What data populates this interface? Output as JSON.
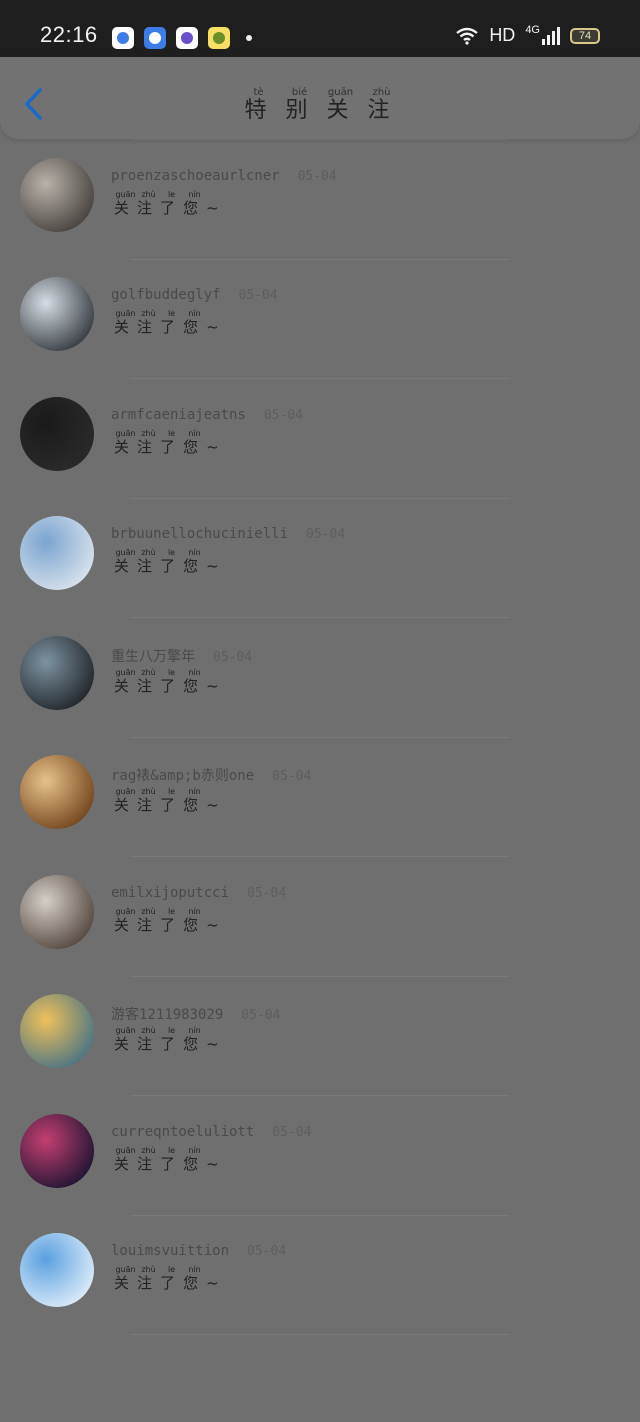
{
  "status_bar": {
    "time": "22:16",
    "network_label": "HD",
    "network_type": "4G",
    "battery": "74",
    "app_icons": [
      {
        "name": "app-icon-1",
        "color": "#ffffff",
        "dot": "#3d7be6"
      },
      {
        "name": "app-icon-2",
        "color": "#3d7be6",
        "dot": "#ffffff"
      },
      {
        "name": "app-icon-3",
        "color": "#ffffff",
        "dot": "#6a4fcf"
      },
      {
        "name": "app-icon-4",
        "color": "#f6df62",
        "dot": "#6a8f2a"
      }
    ]
  },
  "header": {
    "back_icon": "chevron-left-icon",
    "title_chars": [
      "特",
      "别",
      "关",
      "注"
    ],
    "title_pinyin": [
      "tè",
      "bié",
      "guān",
      "zhù"
    ]
  },
  "message_chars": [
    "关",
    "注",
    "了",
    "您",
    "~"
  ],
  "message_pinyin": [
    "guān",
    "zhù",
    "le",
    "nín",
    ""
  ],
  "items": [
    {
      "username": "",
      "date": "",
      "avatar": [
        "#e9b7c5",
        "#7b3350"
      ]
    },
    {
      "username": "proenzaschoeaurlcner",
      "date": "05-04",
      "avatar": [
        "#b9b2aa",
        "#3f3a36"
      ]
    },
    {
      "username": "golfbuddeglyf",
      "date": "05-04",
      "avatar": [
        "#d7dde4",
        "#2a2f36"
      ]
    },
    {
      "username": "armfcaeniajeatns",
      "date": "05-04",
      "avatar": [
        "#1a1a1a",
        "#2b2b2b"
      ]
    },
    {
      "username": "brbuunellochucinielli",
      "date": "05-04",
      "avatar": [
        "#7aa4cf",
        "#dfe6ee"
      ]
    },
    {
      "username": "重生八万擎年",
      "date": "05-04",
      "avatar": [
        "#7d93a2",
        "#1b1e22"
      ]
    },
    {
      "username": "rag裱&amp;b赤则one",
      "date": "05-04",
      "avatar": [
        "#e7c28a",
        "#6b3c16"
      ]
    },
    {
      "username": "emilxijoputcci",
      "date": "05-04",
      "avatar": [
        "#d5cfc8",
        "#4b3e35"
      ]
    },
    {
      "username": "游客1211983029",
      "date": "05-04",
      "avatar": [
        "#f0c15b",
        "#3e6e86"
      ]
    },
    {
      "username": "curreqntoeluliott",
      "date": "05-04",
      "avatar": [
        "#c43f70",
        "#141230"
      ]
    },
    {
      "username": "louimsvuittion",
      "date": "05-04",
      "avatar": [
        "#5aa0e0",
        "#e6f1fb"
      ]
    }
  ]
}
